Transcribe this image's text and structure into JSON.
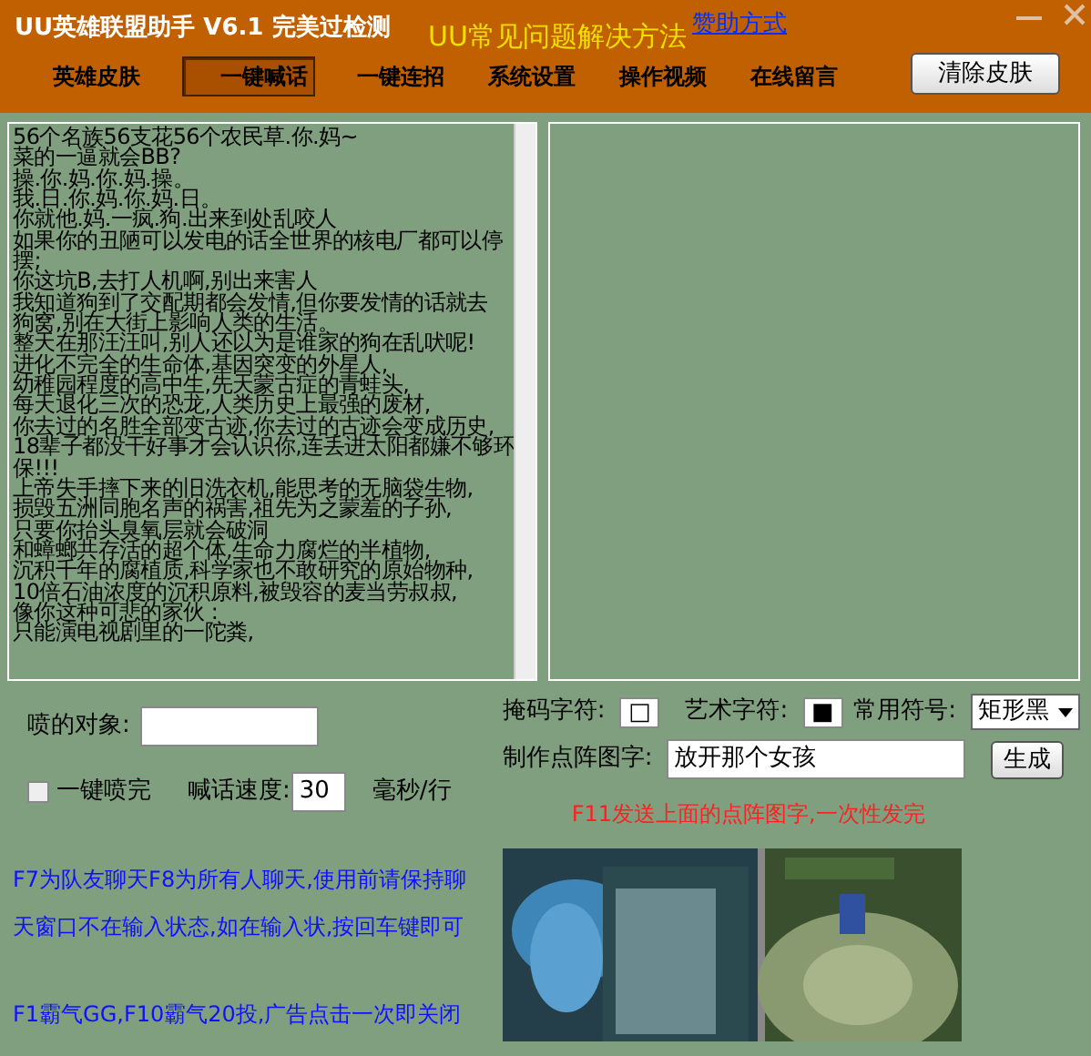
{
  "window": {
    "title": "UU英雄联盟助手 V6.1 完美过检测",
    "help_link": "UU常见问题解决方法",
    "sponsor_link": "赞助方式"
  },
  "tabs": [
    {
      "label": "英雄皮肤",
      "selected": false
    },
    {
      "label": "一键喊话",
      "selected": true
    },
    {
      "label": "一键连招",
      "selected": false
    },
    {
      "label": "系统设置",
      "selected": false
    },
    {
      "label": "操作视频",
      "selected": false
    },
    {
      "label": "在线留言",
      "selected": false
    }
  ],
  "clear_skin_button": "清除皮肤",
  "message_lines": [
    "56个名族56支花56个农民草.你.妈~",
    "菜的一逼就会BB?",
    "操.你.妈.你.妈.操。",
    "我.日.你.妈.你.妈.日。",
    "你就他.妈.一疯.狗.出来到处乱咬人",
    "如果你的丑陋可以发电的话全世界的核电厂都可以停",
    "摆;",
    "你这坑B,去打人机啊,别出来害人",
    "我知道狗到了交配期都会发情,但你要发情的话就去",
    "狗窝,别在大街上影响人类的生活。",
    "整天在那汪汪叫,别人还以为是谁家的狗在乱吠呢!",
    "进化不完全的生命体,基因突变的外星人,",
    "幼稚园程度的高中生,先天蒙古症的青蛙头,",
    "每天退化三次的恐龙,人类历史上最强的废材,",
    "你去过的名胜全部变古迹,你去过的古迹会变成历史,",
    "18辈子都没干好事才会认识你,连丢进太阳都嫌不够环",
    "保!!!",
    "上帝失手摔下来的旧洗衣机,能思考的无脑袋生物,",
    "损毁五洲同胞名声的祸害,祖先为之蒙羞的子孙,",
    "只要你抬头臭氧层就会破洞",
    "和蟑螂共存活的超个体,生命力腐烂的半植物,",
    "沉积千年的腐植质,科学家也不敢研究的原始物种,",
    "10倍石油浓度的沉积原料,被毁容的麦当劳叔叔,",
    "像你这种可悲的家伙 :",
    "只能演电视剧里的一陀粪,"
  ],
  "target": {
    "label": "喷的对象:"
  },
  "one_click_finish": {
    "label": "一键喷完",
    "checked": false
  },
  "speed": {
    "label": "喊话速度:",
    "value": "30",
    "unit": "毫秒/行"
  },
  "mask_char": {
    "label": "掩码字符:",
    "value": "□"
  },
  "art_char": {
    "label": "艺术字符:",
    "value": "■"
  },
  "symbols": {
    "label": "常用符号:",
    "value": "矩形黑"
  },
  "dot_text": {
    "label": "制作点阵图字:",
    "value": "放开那个女孩",
    "button": "生成"
  },
  "f11_note": "F11发送上面的点阵图字,一次性发完",
  "notes": [
    "F7为队友聊天F8为所有人聊天,使用前请保持聊",
    "天窗口不在输入状态,如在输入状,按回车键即可",
    "F1霸气GG,F10霸气20投,广告点击一次即关闭"
  ]
}
